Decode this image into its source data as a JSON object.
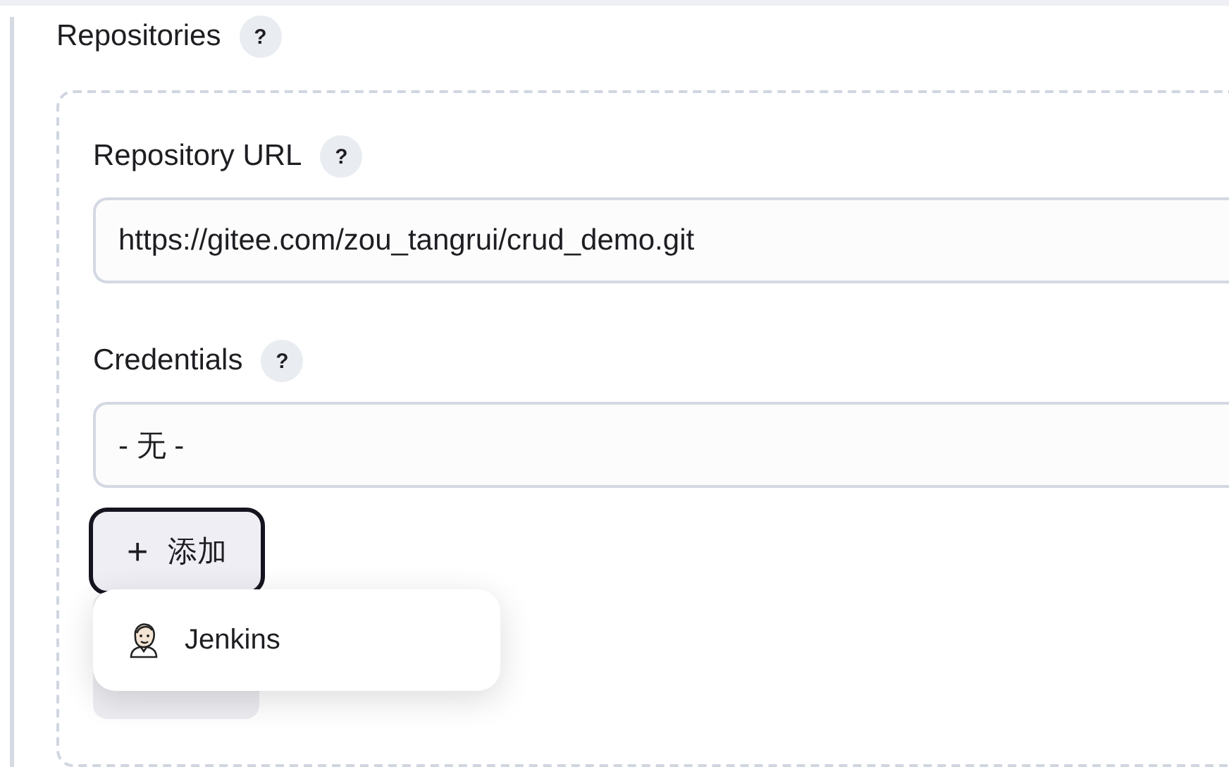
{
  "section": {
    "title": "Repositories",
    "help": "?"
  },
  "fields": [
    {
      "kind": "text",
      "label": "Repository URL",
      "help": "?",
      "value": "https://gitee.com/zou_tangrui/crud_demo.git"
    },
    {
      "kind": "select",
      "label": "Credentials",
      "help": "?",
      "value": "- 无 -"
    }
  ],
  "add_button": {
    "icon": "+",
    "label": "添加",
    "focused": true
  },
  "menu": {
    "items": [
      {
        "label": "Jenkins"
      }
    ]
  }
}
